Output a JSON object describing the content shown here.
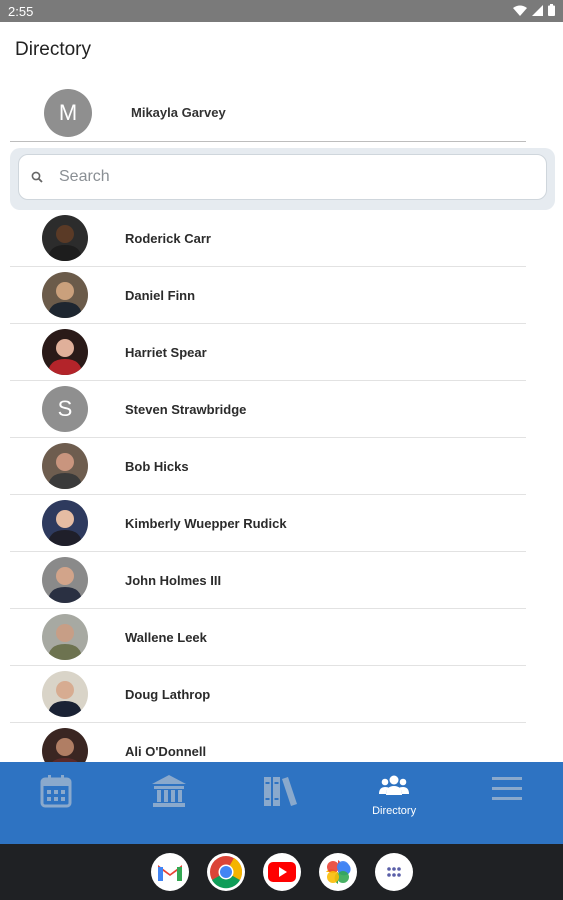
{
  "status_bar": {
    "time": "2:55"
  },
  "header": {
    "title": "Directory"
  },
  "current_user": {
    "initial": "M",
    "name": "Mikayla Garvey"
  },
  "search": {
    "placeholder": "Search",
    "value": ""
  },
  "people": [
    {
      "name": "Roderick Carr",
      "avatar": "photo",
      "initial": "",
      "skin": "#5a3a26",
      "bg": "#2c2c2c",
      "shirt": "#1d1d1d"
    },
    {
      "name": "Daniel Finn",
      "avatar": "photo",
      "initial": "",
      "skin": "#caa07c",
      "bg": "#6b5b4a",
      "shirt": "#1e2630"
    },
    {
      "name": "Harriet Spear",
      "avatar": "photo",
      "initial": "",
      "skin": "#e0b09a",
      "bg": "#2a1a18",
      "shirt": "#b3242a"
    },
    {
      "name": "Steven Strawbridge",
      "avatar": "letter",
      "initial": "S"
    },
    {
      "name": "Bob Hicks",
      "avatar": "photo",
      "initial": "",
      "skin": "#c9957e",
      "bg": "#6e5d4f",
      "shirt": "#3a3a3a"
    },
    {
      "name": "Kimberly Wuepper Rudick",
      "avatar": "photo",
      "initial": "",
      "skin": "#e5bca3",
      "bg": "#2e3a5e",
      "shirt": "#1f1f2a"
    },
    {
      "name": "John Holmes III",
      "avatar": "photo",
      "initial": "",
      "skin": "#d2a48a",
      "bg": "#8a8a8a",
      "shirt": "#2a3042"
    },
    {
      "name": "Wallene Leek",
      "avatar": "photo",
      "initial": "",
      "skin": "#c79e86",
      "bg": "#a7a9a2",
      "shirt": "#6d7350"
    },
    {
      "name": "Doug Lathrop",
      "avatar": "photo",
      "initial": "",
      "skin": "#d7ac91",
      "bg": "#d9d4c8",
      "shirt": "#1a2234"
    },
    {
      "name": "Ali O'Donnell",
      "avatar": "photo",
      "initial": "",
      "skin": "#b07e64",
      "bg": "#3a2622",
      "shirt": "#5a2a2a"
    }
  ],
  "bottom_nav": [
    {
      "icon": "calendar-icon",
      "label": "",
      "active": false
    },
    {
      "icon": "bank-icon",
      "label": "",
      "active": false
    },
    {
      "icon": "library-icon",
      "label": "",
      "active": false
    },
    {
      "icon": "people-icon",
      "label": "Directory",
      "active": true
    },
    {
      "icon": "menu-icon",
      "label": "",
      "active": false
    }
  ],
  "dock_apps": [
    "gmail-icon",
    "chrome-icon",
    "youtube-icon",
    "photos-icon",
    "app-drawer-icon"
  ],
  "colors": {
    "primary": "#2e73c2",
    "nav_inactive_icon": "#8aa9cc",
    "nav_active_icon": "#ffffff",
    "letter_avatar": "#8f8f8f"
  }
}
